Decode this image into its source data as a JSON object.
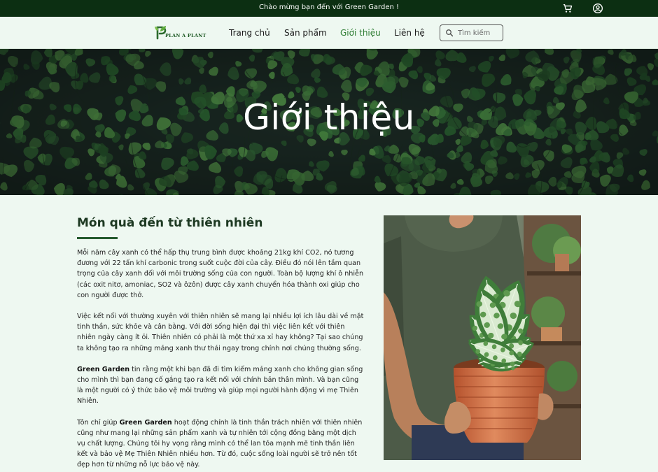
{
  "topbar": {
    "welcome": "Chào mừng bạn đến với Green Garden !",
    "cart_icon": "shopping-cart-icon",
    "account_icon": "account-circle-icon"
  },
  "nav": {
    "logo_text": "PLAN A PLANT",
    "links": [
      {
        "label": "Trang chủ",
        "active": false
      },
      {
        "label": "Sản phẩm",
        "active": false
      },
      {
        "label": "Giới thiệu",
        "active": true
      },
      {
        "label": "Liên hệ",
        "active": false
      }
    ],
    "search_placeholder": "Tìm kiếm",
    "search_icon": "search-icon"
  },
  "hero": {
    "title": "Giới thiệu"
  },
  "about": {
    "title": "Món quà đến từ thiên nhiên",
    "p1": "Mỗi năm cây xanh có thể hấp thụ trung bình được khoảng 21kg khí CO2, nó tương đương với 22 tấn khí carbonic trong suốt cuộc đời của cây. Điều đó nói lên tầm quan trọng của cây xanh đối với môi trường sống của con người. Toàn bộ lượng khí ô nhiễn (các oxit nitơ, amoniac, SO2 và ôzôn) được cây xanh chuyển hóa thành oxi giúp cho con người được thở.",
    "p2": "Việc kết nối với thường xuyên với thiên nhiên sẽ mang lại nhiều lợi ích lâu dài về mặt tinh thần, sức khỏe và cân bằng. Với đời sống hiện đại thì việc liên kết với thiên nhiên ngày càng ít ỏi. Thiên nhiên có phải là một thứ xa xỉ hay không? Tại sao chúng ta không tạo ra những mảng xanh thư thái ngay trong chính nơi chúng thường sống.",
    "p3_strong": "Green Garden",
    "p3_rest": " tin rằng một khi bạn đã đi tìm kiếm mảng xanh cho không gian sống cho mình thì bạn đang cố gắng tạo ra kết nối với chính bản thân mình. Và bạn cũng là một người có ý thức bảo vệ môi trường và giúp mọi người hành động vì mẹ Thiên Nhiên.",
    "p4_pre": "Tôn chỉ giúp ",
    "p4_strong": "Green Garden",
    "p4_rest": " hoạt động chính là tinh thần trách nhiên với thiên nhiên cũng như mang lại những sản phẩm xanh và tự nhiên tới cộng đồng bằng một dịch vụ chất lượng. Chúng tôi hy vọng rằng mình có thể lan tỏa mạnh mẽ tinh thần liên kết và bảo vệ Mẹ Thiên Nhiên nhiều hơn. Từ đó, cuộc sống loài người sẽ trở nên tốt đẹp hơn từ những nỗ lực bảo vệ này."
  },
  "colors": {
    "topbar_bg": "#0c2f12",
    "page_bg": "#eef8f1",
    "accent": "#2f7d34"
  }
}
